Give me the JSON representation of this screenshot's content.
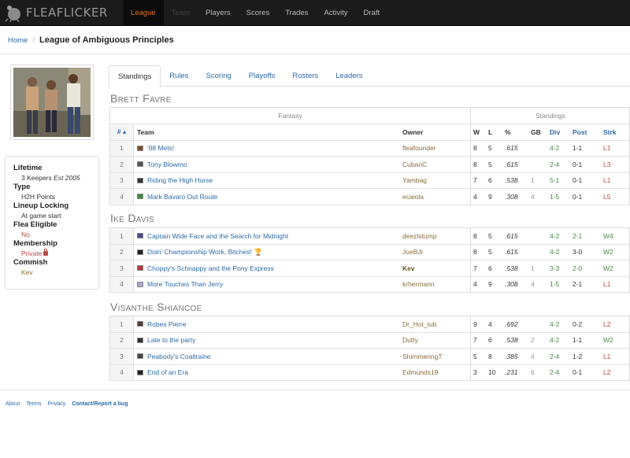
{
  "nav": {
    "brand": "FLEAFLICKER",
    "items": [
      {
        "label": "League",
        "state": "active"
      },
      {
        "label": "Team",
        "state": "dim"
      },
      {
        "label": "Players",
        "state": ""
      },
      {
        "label": "Scores",
        "state": ""
      },
      {
        "label": "Trades",
        "state": ""
      },
      {
        "label": "Activity",
        "state": ""
      },
      {
        "label": "Draft",
        "state": ""
      }
    ]
  },
  "breadcrumb": {
    "home": "Home",
    "sep": "/",
    "title": "League of Ambiguous Principles"
  },
  "sidebar": {
    "lifetime_label": "Lifetime",
    "lifetime_value": "3 Keepers",
    "lifetime_est": "Est 2005",
    "type_label": "Type",
    "type_value": "H2H Points",
    "locking_label": "Lineup Locking",
    "locking_value": "At game start",
    "flea_label": "Flea Eligible",
    "flea_value": "No",
    "membership_label": "Membership",
    "membership_value": "Private",
    "commish_label": "Commish",
    "commish_value": "Kev"
  },
  "tabs": [
    "Standings",
    "Rules",
    "Scoring",
    "Playoffs",
    "Rosters",
    "Leaders"
  ],
  "headers": {
    "fantasy": "Fantasy",
    "standings": "Standings",
    "rank": "# ▴",
    "team": "Team",
    "owner": "Owner",
    "w": "W",
    "l": "L",
    "pct": "%",
    "gb": "GB",
    "div": "Div",
    "post": "Post",
    "strk": "Strk"
  },
  "divisions": [
    {
      "name": "Brett Favre",
      "rows": [
        {
          "rank": "1",
          "team": "'08 Mets!",
          "owner": "fleafounder",
          "w": "8",
          "l": "5",
          "pct": ".615",
          "gb": "",
          "div": "4-2",
          "post": "1-1",
          "strk": "L1",
          "icon_color": "#7a5030"
        },
        {
          "rank": "2",
          "team": "Tony Blowmo",
          "owner": "CubanC",
          "w": "8",
          "l": "5",
          "pct": ".615",
          "gb": "",
          "div": "2-4",
          "post": "0-1",
          "strk": "L3",
          "icon_color": "#555"
        },
        {
          "rank": "3",
          "team": "Riding the High Horse",
          "owner": "Yambag",
          "w": "7",
          "l": "6",
          "pct": ".538",
          "gb": "1",
          "div": "5-1",
          "post": "0-1",
          "strk": "L1",
          "icon_color": "#333"
        },
        {
          "rank": "4",
          "team": "Mark Bavaro Out Route",
          "owner": "ecaiola",
          "w": "4",
          "l": "9",
          "pct": ".308",
          "gb": "4",
          "div": "1-5",
          "post": "0-1",
          "strk": "L5",
          "icon_color": "#3c8a3c"
        }
      ]
    },
    {
      "name": "Ike Davis",
      "rows": [
        {
          "rank": "1",
          "team": "Captain Wide Face and the Search for Midnight",
          "owner": "deezlstump",
          "w": "8",
          "l": "5",
          "pct": ".615",
          "gb": "",
          "div": "4-2",
          "post": "2-1",
          "strk": "W4",
          "icon_color": "#4a4a8a"
        },
        {
          "rank": "2",
          "team": "Doin' Championship Work, Bitches!",
          "trophy": "🏆",
          "owner": "JoeBJr",
          "w": "8",
          "l": "5",
          "pct": ".615",
          "gb": "",
          "div": "4-2",
          "post": "3-0",
          "strk": "W2",
          "icon_color": "#222"
        },
        {
          "rank": "3",
          "team": "Choppy's Schnappy and the Pony Express",
          "owner": "Kev",
          "owner_bold": true,
          "w": "7",
          "l": "6",
          "pct": ".538",
          "gb": "1",
          "div": "3-3",
          "post": "2-0",
          "strk": "W2",
          "icon_color": "#b33"
        },
        {
          "rank": "4",
          "team": "More Touches Than Jerry",
          "owner": "krhermann",
          "w": "4",
          "l": "9",
          "pct": ".308",
          "gb": "4",
          "div": "1-5",
          "post": "2-1",
          "strk": "L1",
          "icon_color": "#aac"
        }
      ]
    },
    {
      "name": "Visanthe Shiancoe",
      "rows": [
        {
          "rank": "1",
          "team": "Robes Pierre",
          "owner": "Dr_Hot_tub",
          "w": "9",
          "l": "4",
          "pct": ".692",
          "gb": "",
          "div": "4-2",
          "post": "0-2",
          "strk": "L2",
          "icon_color": "#5a3a3a"
        },
        {
          "rank": "2",
          "team": "Late to the party",
          "owner": "Dutty",
          "w": "7",
          "l": "6",
          "pct": ".538",
          "gb": "2",
          "div": "4-2",
          "post": "1-1",
          "strk": "W2",
          "icon_color": "#333"
        },
        {
          "rank": "3",
          "team": "Peabody's Coaltraine",
          "owner": "ShimmeringT",
          "w": "5",
          "l": "8",
          "pct": ".385",
          "gb": "4",
          "div": "2-4",
          "post": "1-2",
          "strk": "L1",
          "icon_color": "#444"
        },
        {
          "rank": "4",
          "team": "End of an Era",
          "owner": "Edmunds19",
          "w": "3",
          "l": "10",
          "pct": ".231",
          "gb": "6",
          "div": "2-4",
          "post": "0-1",
          "strk": "L2",
          "icon_color": "#222"
        }
      ]
    }
  ],
  "footer": [
    "About",
    "Terms",
    "Privacy",
    "Contact/Report a bug"
  ]
}
